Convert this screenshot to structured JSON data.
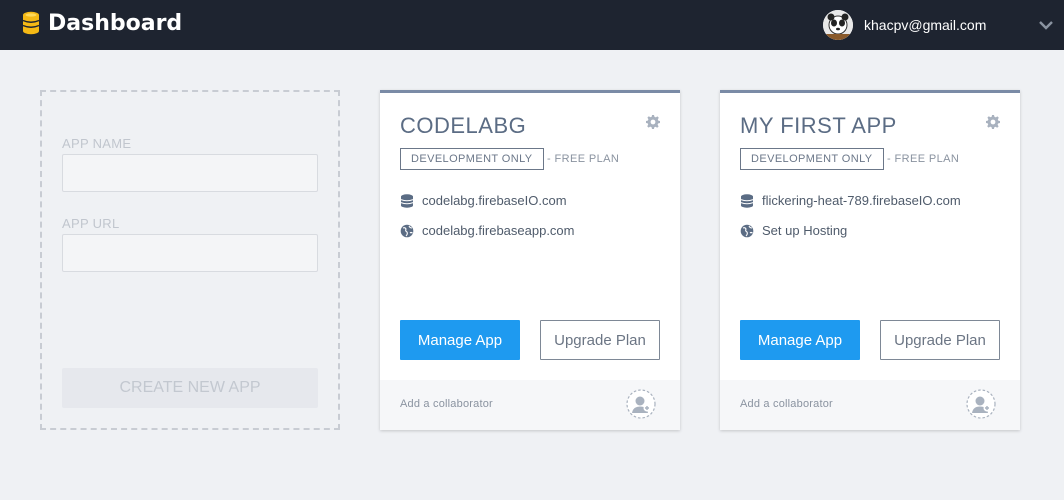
{
  "header": {
    "title": "Dashboard",
    "user_email": "khacpv@gmail.com",
    "icons": {
      "brand": "database-coins-icon",
      "avatar": "user-avatar",
      "menu": "chevron-down-icon"
    }
  },
  "create_app": {
    "app_name_label": "APP NAME",
    "app_name_value": "",
    "app_url_label": "APP URL",
    "app_url_value": "",
    "create_button_label": "CREATE NEW APP"
  },
  "apps": [
    {
      "name": "CODELABG",
      "plan_badge": "DEVELOPMENT ONLY",
      "plan_suffix": "- FREE PLAN",
      "database_url": "codelabg.firebaseIO.com",
      "hosting": "codelabg.firebaseapp.com",
      "manage_label": "Manage App",
      "upgrade_label": "Upgrade Plan",
      "collaborator_label": "Add a collaborator"
    },
    {
      "name": "MY FIRST APP",
      "plan_badge": "DEVELOPMENT ONLY",
      "plan_suffix": "- FREE PLAN",
      "database_url": "flickering-heat-789.firebaseIO.com",
      "hosting": "Set up Hosting",
      "manage_label": "Manage App",
      "upgrade_label": "Upgrade Plan",
      "collaborator_label": "Add a collaborator"
    }
  ],
  "colors": {
    "topbar": "#1e2430",
    "accent": "#1e9af0",
    "card_top_border": "#7a8ba6",
    "background": "#eff1f4"
  }
}
